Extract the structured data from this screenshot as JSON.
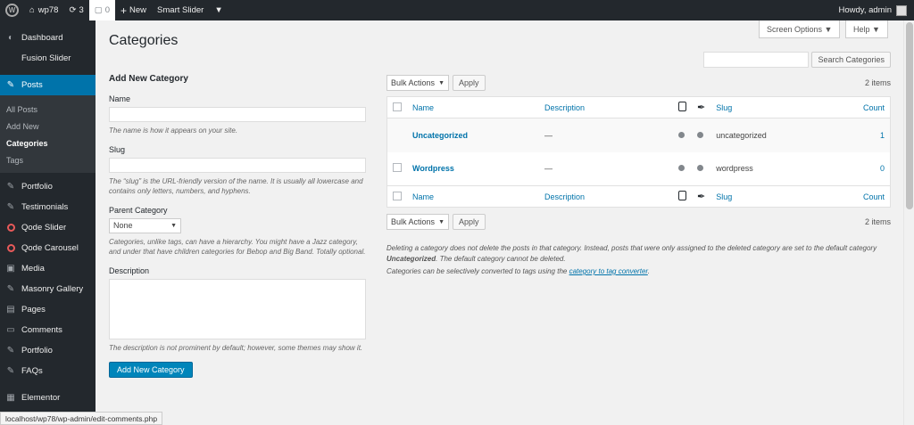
{
  "adminbar": {
    "site_name": "wp78",
    "updates_count": "3",
    "comments_count": "0",
    "new_label": "New",
    "smart_slider_label": "Smart Slider",
    "howdy": "Howdy, admin"
  },
  "sidebar": {
    "items": [
      {
        "label": "Dashboard",
        "icon": "dashboard-icon"
      },
      {
        "label": "Fusion Slider",
        "icon": ""
      },
      {
        "label": "Posts",
        "icon": "pushpin-icon"
      },
      {
        "label": "Portfolio",
        "icon": "pushpin-icon"
      },
      {
        "label": "Testimonials",
        "icon": "pushpin-icon"
      },
      {
        "label": "Qode Slider",
        "icon": "qode-icon"
      },
      {
        "label": "Qode Carousel",
        "icon": "qode-icon"
      },
      {
        "label": "Media",
        "icon": "media-icon"
      },
      {
        "label": "Masonry Gallery",
        "icon": "pushpin-icon"
      },
      {
        "label": "Pages",
        "icon": "pages-icon"
      },
      {
        "label": "Comments",
        "icon": "comments-icon"
      },
      {
        "label": "Portfolio",
        "icon": "pushpin-icon"
      },
      {
        "label": "FAQs",
        "icon": "pushpin-icon"
      },
      {
        "label": "Elementor",
        "icon": "elementor-icon"
      }
    ],
    "submenu": [
      "All Posts",
      "Add New",
      "Categories",
      "Tags"
    ]
  },
  "header": {
    "title": "Categories",
    "screen_options": "Screen Options ▼",
    "help": "Help ▼"
  },
  "form": {
    "heading": "Add New Category",
    "name_label": "Name",
    "name_help": "The name is how it appears on your site.",
    "slug_label": "Slug",
    "slug_help": "The “slug” is the URL-friendly version of the name. It is usually all lowercase and contains only letters, numbers, and hyphens.",
    "parent_label": "Parent Category",
    "parent_value": "None",
    "parent_help": "Categories, unlike tags, can have a hierarchy. You might have a Jazz category, and under that have children categories for Bebop and Big Band. Totally optional.",
    "description_label": "Description",
    "description_help": "The description is not prominent by default; however, some themes may show it.",
    "submit": "Add New Category"
  },
  "list": {
    "search_button": "Search Categories",
    "bulk_actions": "Bulk Actions",
    "apply": "Apply",
    "items_count": "2 items",
    "columns": {
      "name": "Name",
      "description": "Description",
      "slug": "Slug",
      "count": "Count"
    },
    "rows": [
      {
        "name": "Uncategorized",
        "description": "—",
        "slug": "uncategorized",
        "count": "1"
      },
      {
        "name": "Wordpress",
        "description": "—",
        "slug": "wordpress",
        "count": "0"
      }
    ],
    "note1_a": "Deleting a category does not delete the posts in that category. Instead, posts that were only assigned to the deleted category are set to the default category ",
    "note1_b": "Uncategorized",
    "note1_c": ". The default category cannot be deleted.",
    "note2_a": "Categories can be selectively converted to tags using the ",
    "note2_link": "category to tag converter",
    "note2_b": "."
  },
  "statusbar": {
    "url": "localhost/wp78/wp-admin/edit-comments.php"
  }
}
